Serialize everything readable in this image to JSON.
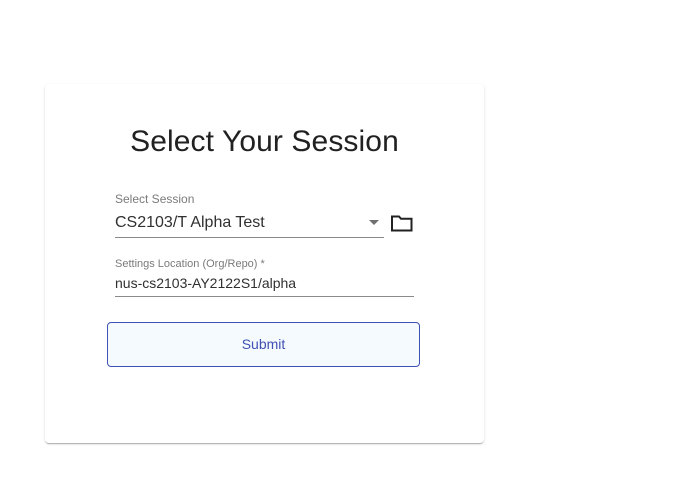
{
  "card": {
    "title": "Select Your Session"
  },
  "session": {
    "label": "Select Session",
    "selected_value": "CS2103/T Alpha Test",
    "dropdown_icon": "caret-down-icon",
    "folder_icon": "folder-icon"
  },
  "settings": {
    "label": "Settings Location (Org/Repo) *",
    "value": "nus-cs2103-AY2122S1/alpha"
  },
  "actions": {
    "submit_label": "Submit"
  },
  "colors": {
    "accent": "#3f51b5",
    "button_bg": "#f5fafe",
    "title": "#212121",
    "label": "#7a7a7a"
  }
}
